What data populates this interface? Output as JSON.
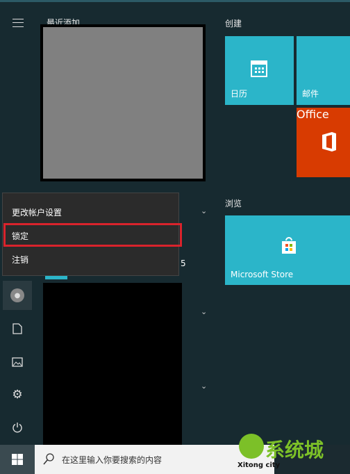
{
  "start_menu": {
    "recent_header": "最近添加",
    "groups": [
      {
        "title": "创建",
        "tiles": [
          {
            "label": "日历",
            "icon": "calendar-icon"
          },
          {
            "label": "邮件",
            "icon": "mail-icon"
          },
          {
            "label": "Office",
            "icon": "office-icon",
            "color": "#d83b01"
          }
        ]
      },
      {
        "title": "浏览",
        "tiles": [
          {
            "label": "Microsoft Store",
            "icon": "store-icon"
          }
        ]
      }
    ],
    "list_fragment": "5",
    "tile_color": "#2bb5c9"
  },
  "account_menu": {
    "items": [
      {
        "label": "更改帐户设置"
      },
      {
        "label": "锁定",
        "highlighted": true
      },
      {
        "label": "注销"
      }
    ],
    "highlight_color": "#d9232c"
  },
  "sidebar": [
    "user-avatar-icon",
    "document-icon",
    "pictures-icon",
    "settings-icon",
    "power-icon"
  ],
  "taskbar": {
    "search_placeholder": "在这里输入你要搜索的内容"
  },
  "watermark": {
    "text": "系统城",
    "subtext": "Xitong city"
  }
}
